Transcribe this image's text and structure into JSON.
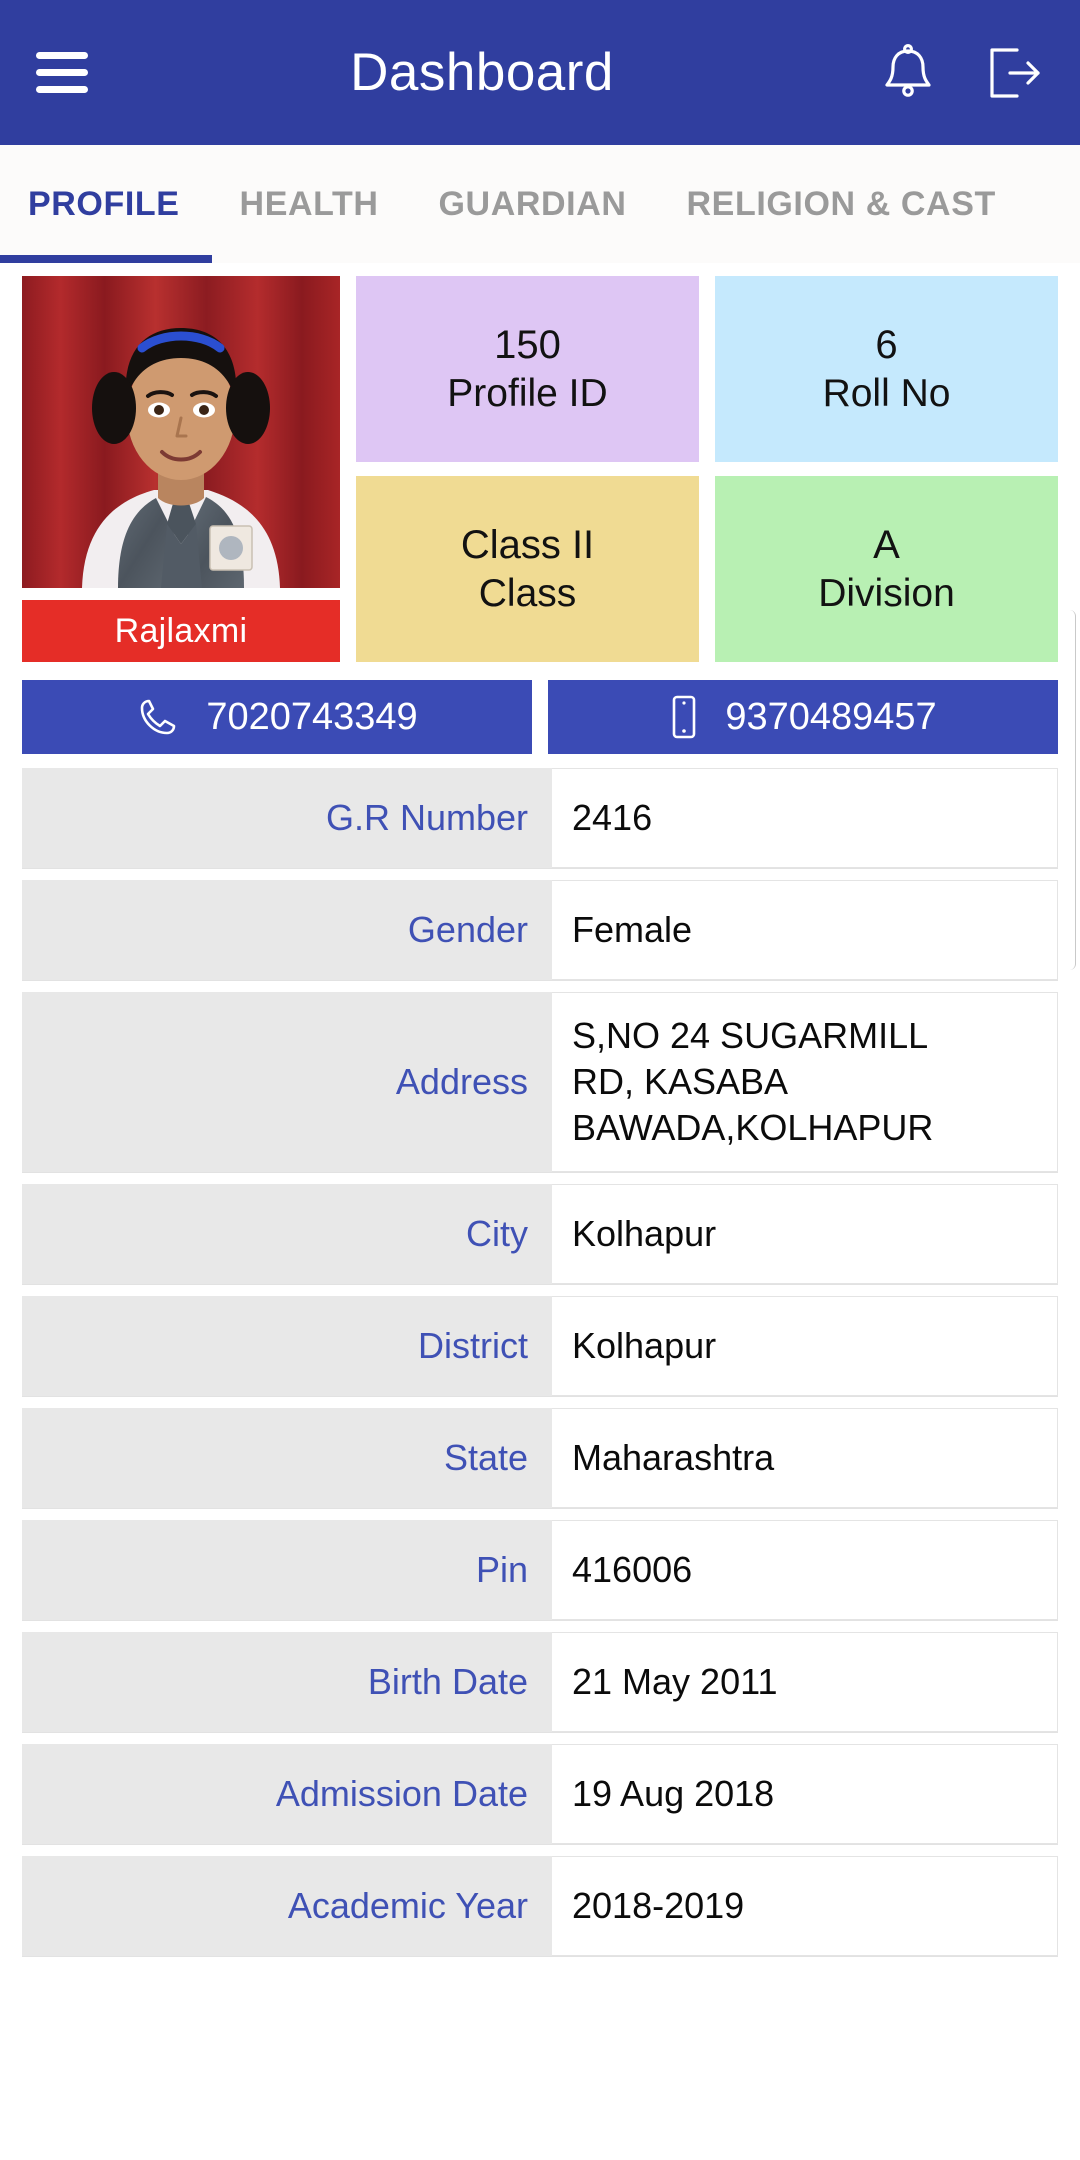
{
  "appbar": {
    "title": "Dashboard",
    "menu_icon": "hamburger-menu-icon",
    "notification_icon": "bell-icon",
    "logout_icon": "logout-icon",
    "background_color": "#303E9F"
  },
  "tabs": [
    {
      "label": "PROFILE",
      "active": true
    },
    {
      "label": "HEALTH",
      "active": false
    },
    {
      "label": "GUARDIAN",
      "active": false
    },
    {
      "label": "RELIGION & CAST",
      "active": false
    }
  ],
  "profile": {
    "student_name": "Rajlaxmi",
    "photo_alt": "student-photo",
    "name_band_color": "#E52D27"
  },
  "cards": [
    {
      "value": "150",
      "label": "Profile ID",
      "color": "#DEC6F4"
    },
    {
      "value": "6",
      "label": "Roll No",
      "color": "#C5E9FD"
    },
    {
      "value": "Class II",
      "label": "Class",
      "color": "#F0DB93"
    },
    {
      "value": "A",
      "label": "Division",
      "color": "#B8F0B3"
    }
  ],
  "contacts": [
    {
      "icon": "phone-handset-icon",
      "number": "7020743349"
    },
    {
      "icon": "mobile-phone-icon",
      "number": "9370489457"
    }
  ],
  "details": [
    {
      "label": "G.R Number",
      "value": "2416"
    },
    {
      "label": "Gender",
      "value": "Female"
    },
    {
      "label": "Address",
      "value": "S,NO 24 SUGARMILL\nRD, KASABA\nBAWADA,KOLHAPUR",
      "tall": true
    },
    {
      "label": "City",
      "value": "Kolhapur"
    },
    {
      "label": "District",
      "value": "Kolhapur"
    },
    {
      "label": "State",
      "value": "Maharashtra"
    },
    {
      "label": "Pin",
      "value": "416006"
    },
    {
      "label": "Birth Date",
      "value": "21 May 2011"
    },
    {
      "label": "Admission Date",
      "value": "19 Aug 2018"
    },
    {
      "label": "Academic Year",
      "value": "2018-2019"
    }
  ]
}
